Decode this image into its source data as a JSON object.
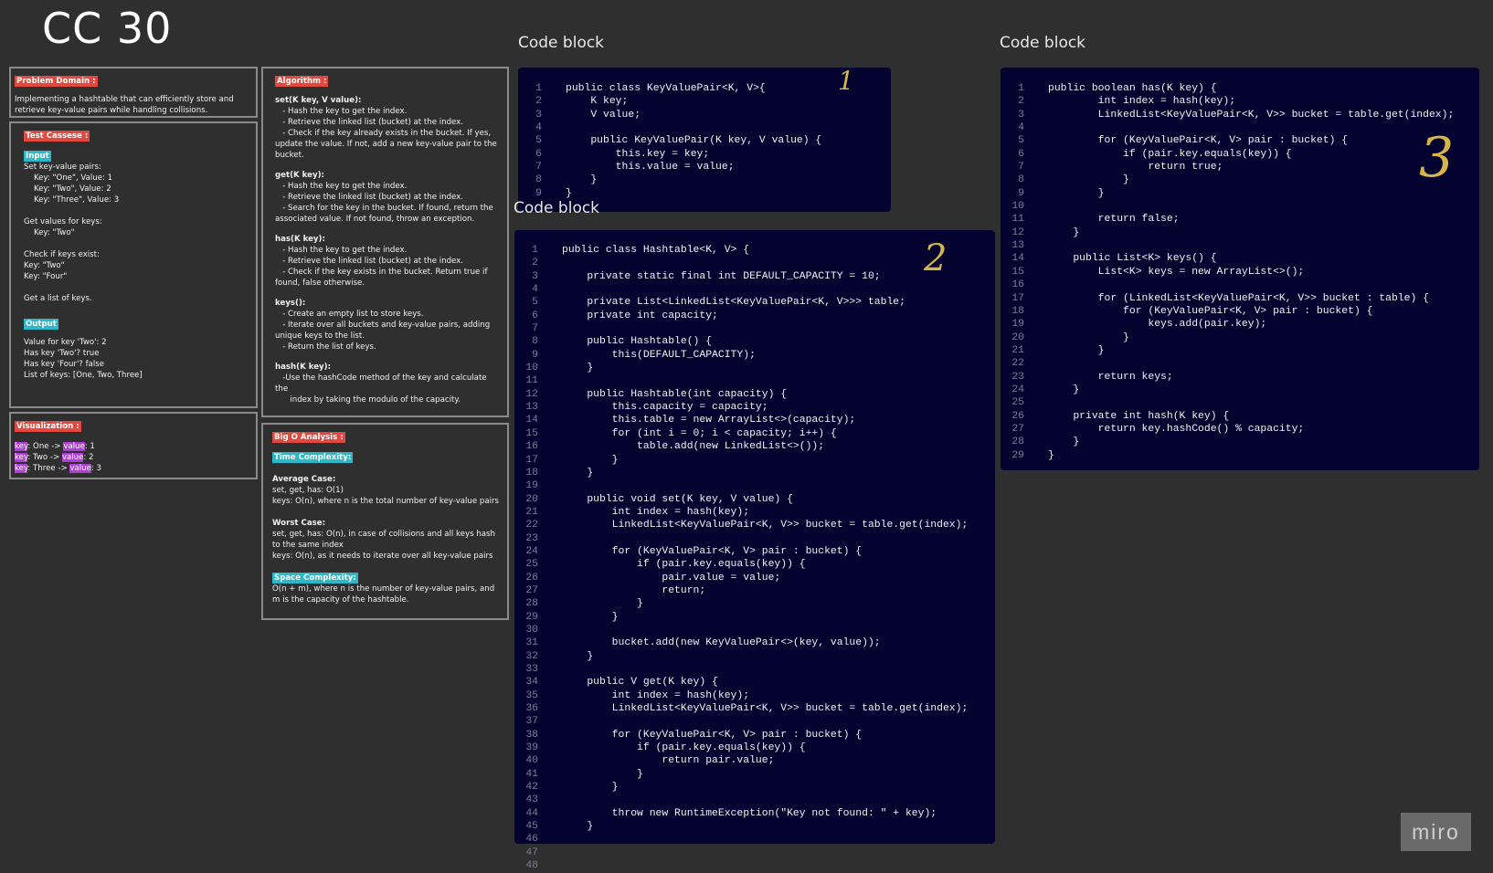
{
  "board_title": "CC 30",
  "problem_domain": {
    "label": "Problem Domain :",
    "text": "Implementing a hashtable that can efficiently store and retrieve key-value pairs while handling collisions."
  },
  "test_cases": {
    "label": "Test Cassese :",
    "input_label": "Input",
    "input_text": "Set key-value pairs:\n    Key: \"One\", Value: 1\n    Key: \"Two\", Value: 2\n    Key: \"Three\", Value: 3\n\nGet values for keys:\n    Key: \"Two\"\n\nCheck if keys exist:\nKey: \"Two\"\nKey: \"Four\"\n\nGet a list of keys.",
    "output_label": "Output",
    "output_text": "Value for key 'Two': 2\nHas key 'Two'? true\nHas key 'Four'? false\nList of keys: [One, Two, Three]"
  },
  "visualization": {
    "label": "Visualization :",
    "rows": [
      {
        "key_word": "key",
        "middle": ": One -> ",
        "value_word": "value",
        "end": ": 1"
      },
      {
        "key_word": "key",
        "middle": ": Two -> ",
        "value_word": "value",
        "end": ": 2"
      },
      {
        "key_word": "key",
        "middle": ": Three -> ",
        "value_word": "value",
        "end": ": 3"
      }
    ]
  },
  "algorithm": {
    "label": "Algorithm :",
    "sections": [
      {
        "heading": "set(K key, V value):",
        "body": "   - Hash the key to get the index.\n   - Retrieve the linked list (bucket) at the index.\n   - Check if the key already exists in the bucket. If yes, update the value. If not, add a new key-value pair to the bucket."
      },
      {
        "heading": "get(K key):",
        "body": "   - Hash the key to get the index.\n   - Retrieve the linked list (bucket) at the index.\n   - Search for the key in the bucket. If found, return the associated value. If not found, throw an exception."
      },
      {
        "heading": "has(K key):",
        "body": "   - Hash the key to get the index.\n   - Retrieve the linked list (bucket) at the index.\n   - Check if the key exists in the bucket. Return true if found, false otherwise."
      },
      {
        "heading": "keys():",
        "body": "   - Create an empty list to store keys.\n   - Iterate over all buckets and key-value pairs, adding unique keys to the list.\n   - Return the list of keys."
      },
      {
        "heading": "hash(K key):",
        "body": "   -Use the hashCode method of the key and calculate the\n      index by taking the modulo of the capacity."
      }
    ]
  },
  "big_o": {
    "label": "Big O Analysis :",
    "time_label": "Time Complexity:",
    "average_heading": "Average Case:",
    "average_body": "set, get, has: O(1)\nkeys: O(n), where n is the total number of key-value pairs",
    "worst_heading": "Worst Case:",
    "worst_body": "set, get, has: O(n), in case of collisions and all keys hash to the same index\nkeys: O(n), as it needs to iterate over all key-value pairs",
    "space_label": "Space Complexity:",
    "space_body": "O(n + m), where n is the number of key-value pairs, and m is the capacity of the hashtable."
  },
  "code_blocks": {
    "block1": {
      "label": "Code block",
      "annotation": "1",
      "lines": [
        "public class KeyValuePair<K, V>{",
        "    K key;",
        "    V value;",
        "",
        "    public KeyValuePair(K key, V value) {",
        "        this.key = key;",
        "        this.value = value;",
        "    }",
        "}"
      ]
    },
    "block2": {
      "label": "Code block",
      "annotation": "2",
      "lines": [
        "public class Hashtable<K, V> {",
        "",
        "    private static final int DEFAULT_CAPACITY = 10;",
        "",
        "    private List<LinkedList<KeyValuePair<K, V>>> table;",
        "    private int capacity;",
        "",
        "    public Hashtable() {",
        "        this(DEFAULT_CAPACITY);",
        "    }",
        "",
        "    public Hashtable(int capacity) {",
        "        this.capacity = capacity;",
        "        this.table = new ArrayList<>(capacity);",
        "        for (int i = 0; i < capacity; i++) {",
        "            table.add(new LinkedList<>());",
        "        }",
        "    }",
        "",
        "    public void set(K key, V value) {",
        "        int index = hash(key);",
        "        LinkedList<KeyValuePair<K, V>> bucket = table.get(index);",
        "",
        "        for (KeyValuePair<K, V> pair : bucket) {",
        "            if (pair.key.equals(key)) {",
        "                pair.value = value;",
        "                return;",
        "            }",
        "        }",
        "",
        "        bucket.add(new KeyValuePair<>(key, value));",
        "    }",
        "",
        "    public V get(K key) {",
        "        int index = hash(key);",
        "        LinkedList<KeyValuePair<K, V>> bucket = table.get(index);",
        "",
        "        for (KeyValuePair<K, V> pair : bucket) {",
        "            if (pair.key.equals(key)) {",
        "                return pair.value;",
        "            }",
        "        }",
        "",
        "        throw new RuntimeException(\"Key not found: \" + key);",
        "    }",
        "",
        "",
        ""
      ]
    },
    "block3": {
      "label": "Code block",
      "annotation": "3",
      "lines": [
        "public boolean has(K key) {",
        "        int index = hash(key);",
        "        LinkedList<KeyValuePair<K, V>> bucket = table.get(index);",
        "",
        "        for (KeyValuePair<K, V> pair : bucket) {",
        "            if (pair.key.equals(key)) {",
        "                return true;",
        "            }",
        "        }",
        "",
        "        return false;",
        "    }",
        "",
        "    public List<K> keys() {",
        "        List<K> keys = new ArrayList<>();",
        "",
        "        for (LinkedList<KeyValuePair<K, V>> bucket : table) {",
        "            for (KeyValuePair<K, V> pair : bucket) {",
        "                keys.add(pair.key);",
        "            }",
        "        }",
        "",
        "        return keys;",
        "    }",
        "",
        "    private int hash(K key) {",
        "        return key.hashCode() % capacity;",
        "    }",
        "}"
      ]
    }
  },
  "brand": "miro"
}
